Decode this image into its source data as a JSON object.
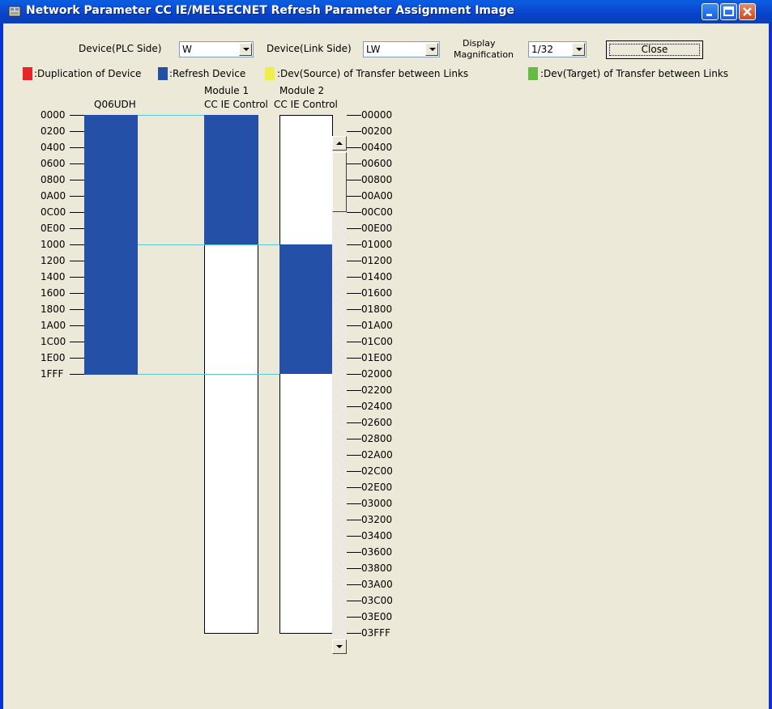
{
  "window": {
    "title": "Network Parameter  CC IE/MELSECNET Refresh Parameter Assignment Image"
  },
  "controls": {
    "plc_side_label": "Device(PLC Side)",
    "plc_side_value": "W",
    "link_side_label": "Device(Link Side)",
    "link_side_value": "LW",
    "display_label_1": "Display",
    "display_label_2": "Magnification",
    "magnification_value": "1/32",
    "close_label": "Close"
  },
  "legend": [
    {
      "label": ":Duplication of Device",
      "color": "#e8262a"
    },
    {
      "label": ":Refresh Device",
      "color": "#2451a7"
    },
    {
      "label": ":Dev(Source) of Transfer between Links",
      "color": "#f1ee4a"
    },
    {
      "label": ":Dev(Target) of Transfer between Links",
      "color": "#66bb44"
    }
  ],
  "columns": {
    "plc": {
      "name": "Q06UDH"
    },
    "module1": {
      "line1": "Module 1",
      "line2": "CC IE Control"
    },
    "module2": {
      "line1": "Module 2",
      "line2": "CC IE Control"
    }
  },
  "plc_axis": [
    "0000",
    "0200",
    "0400",
    "0600",
    "0800",
    "0A00",
    "0C00",
    "0E00",
    "1000",
    "1200",
    "1400",
    "1600",
    "1800",
    "1A00",
    "1C00",
    "1E00",
    "1FFF"
  ],
  "link_axis": [
    "00000",
    "00200",
    "00400",
    "00600",
    "00800",
    "00A00",
    "00C00",
    "00E00",
    "01000",
    "01200",
    "01400",
    "01600",
    "01800",
    "01A00",
    "01C00",
    "01E00",
    "02000",
    "02200",
    "02400",
    "02600",
    "02800",
    "02A00",
    "02C00",
    "02E00",
    "03000",
    "03200",
    "03400",
    "03600",
    "03800",
    "03A00",
    "03C00",
    "03E00",
    "03FFF"
  ],
  "refresh_ranges": {
    "plc": {
      "start": "0000",
      "end": "1FFF"
    },
    "module1": {
      "start": "00000",
      "end": "00FFF"
    },
    "module2": {
      "start": "01000",
      "end": "01FFF"
    }
  },
  "colors": {
    "refresh": "#2451a7",
    "link_line": "#5bc2d8"
  }
}
